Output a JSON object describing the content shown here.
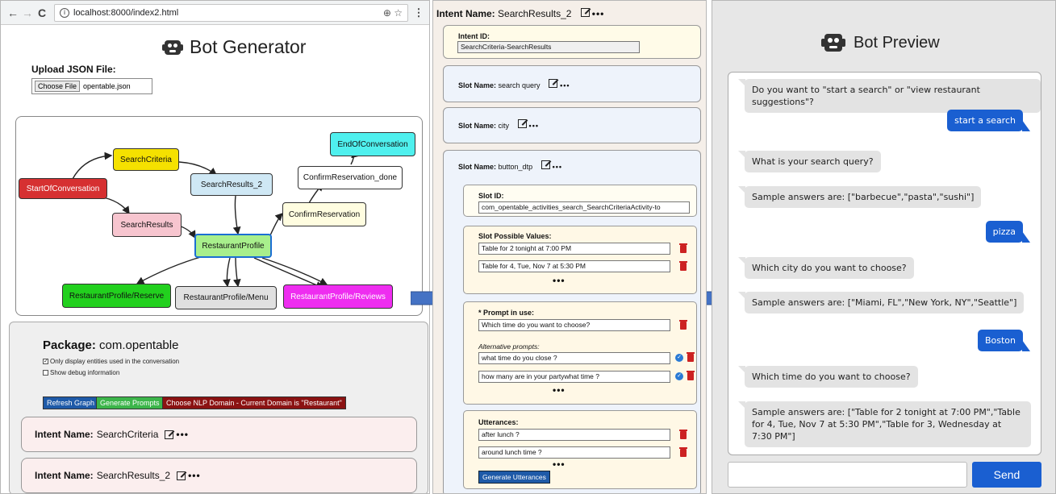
{
  "browser": {
    "back_icon": "←",
    "forward_icon": "→",
    "reload_icon": "C",
    "url": "localhost:8000/index2.html"
  },
  "left": {
    "title": "Bot Generator",
    "upload_label": "Upload JSON File:",
    "choose_file_label": "Choose File",
    "file_name": "opentable.json",
    "graph": {
      "nodes": [
        "StartOfConversation",
        "SearchCriteria",
        "SearchResults_2",
        "SearchResults",
        "RestaurantProfile",
        "ConfirmReservation",
        "ConfirmReservation_done",
        "EndOfConversation",
        "RestaurantProfile/Reserve",
        "RestaurantProfile/Menu",
        "RestaurantProfile/Reviews"
      ],
      "colors": {
        "StartOfConversation": "#d63031",
        "SearchCriteria": "#f5e100",
        "SearchResults_2": "#cfe8f5",
        "SearchResults": "#f7c5cf",
        "RestaurantProfile": "#a8ef8c",
        "ConfirmReservation": "#fffde0",
        "ConfirmReservation_done": "#ffffff",
        "EndOfConversation": "#4ff0ee",
        "RestaurantProfile/Reserve": "#22d01e",
        "RestaurantProfile/Menu": "#e0e0e0",
        "RestaurantProfile/Reviews": "#ee2df0"
      }
    },
    "package": {
      "label": "Package:",
      "name": "com.opentable",
      "check1": "Only display entities used in the conversation",
      "check2": "Show debug information",
      "refresh_button": "Refresh Graph",
      "generate_button": "Generate Prompts",
      "domain_button": "Choose NLP Domain - Current Domain is \"Restaurant\"",
      "intents": [
        {
          "label": "Intent Name:",
          "name": "SearchCriteria"
        },
        {
          "label": "Intent Name:",
          "name": "SearchResults_2"
        }
      ],
      "dots": "•••"
    }
  },
  "middle": {
    "intent_label": "Intent Name:",
    "intent_name": "SearchResults_2",
    "dots": "•••",
    "intent_id_label": "Intent ID:",
    "intent_id_value": "SearchCriteria-SearchResults",
    "slot_label": "Slot Name:",
    "slots": [
      "search query",
      "city",
      "button_dtp"
    ],
    "slot_id_label": "Slot ID:",
    "slot_id_value": "com_opentable_activities_search_SearchCriteriaActivity-to",
    "possible_values_label": "Slot Possible Values:",
    "possible_values": [
      "Table for 2 tonight at 7:00 PM",
      "Table for 4, Tue, Nov 7 at 5:30 PM"
    ],
    "prompt_label": "* Prompt in use:",
    "prompt_value": "Which time do you want to choose?",
    "alt_prompts_label": "Alternative prompts:",
    "alt_prompts": [
      "what time do you close ?",
      "how many are in your partywhat time ?"
    ],
    "utterances_label": "Utterances:",
    "utterances": [
      "after lunch ?",
      "around lunch time ?"
    ],
    "generate_utterances": "Generate Utterances"
  },
  "right": {
    "title": "Bot Preview",
    "messages": [
      {
        "from": "bot",
        "text": "Do you want to \"start a search\" or \"view restaurant suggestions\"?"
      },
      {
        "from": "user",
        "text": "start a search"
      },
      {
        "from": "bot",
        "text": "What is your search query?"
      },
      {
        "from": "bot",
        "text": "Sample answers are: [\"barbecue\",\"pasta\",\"sushi\"]"
      },
      {
        "from": "user",
        "text": "pizza"
      },
      {
        "from": "bot",
        "text": "Which city do you want to choose?"
      },
      {
        "from": "bot",
        "text": "Sample answers are: [\"Miami, FL\",\"New York, NY\",\"Seattle\"]"
      },
      {
        "from": "user",
        "text": "Boston"
      },
      {
        "from": "bot",
        "text": "Which time do you want to choose?"
      },
      {
        "from": "bot",
        "text": "Sample answers are: [\"Table for 2 tonight at 7:00 PM\",\"Table for 4, Tue, Nov 7 at 5:30 PM\",\"Table for 3, Wednesday at 7:30 PM\"]"
      }
    ],
    "input_value": "",
    "send_label": "Send"
  }
}
